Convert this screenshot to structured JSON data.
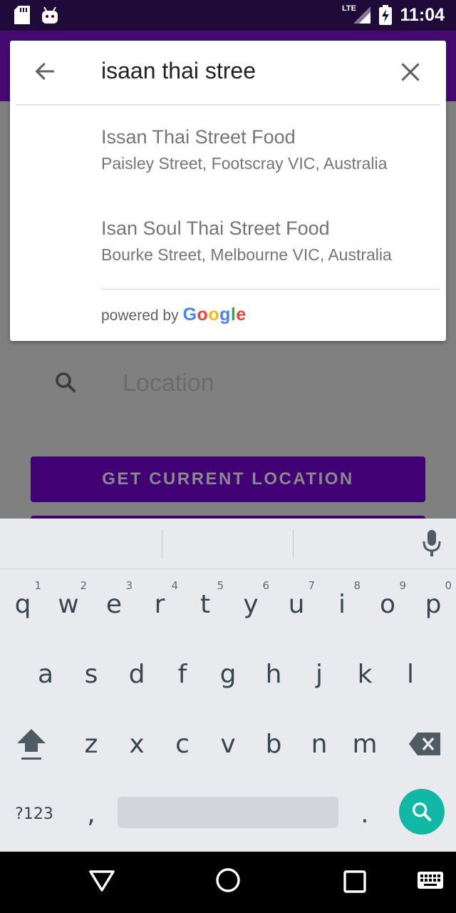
{
  "status_bar": {
    "time": "11:04",
    "network": "LTE",
    "icons": [
      "sd-card-icon",
      "android-icon",
      "signal-icon",
      "battery-charging-icon"
    ]
  },
  "search": {
    "query": "isaan thai stree",
    "suggestions": [
      {
        "name": "Issan Thai Street Food",
        "address": "Paisley Street, Footscray VIC, Australia"
      },
      {
        "name": "Isan Soul Thai Street Food",
        "address": "Bourke Street, Melbourne VIC, Australia"
      }
    ],
    "powered_by": "powered by",
    "google_letters": [
      "G",
      "o",
      "o",
      "g",
      "l",
      "e"
    ],
    "google_colors": [
      "#4285F4",
      "#EA4335",
      "#FBBC05",
      "#4285F4",
      "#34A853",
      "#EA4335"
    ]
  },
  "form": {
    "location_placeholder": "Location",
    "current_location_button": "GET CURRENT LOCATION"
  },
  "keyboard": {
    "row1": [
      {
        "k": "q",
        "h": "1"
      },
      {
        "k": "w",
        "h": "2"
      },
      {
        "k": "e",
        "h": "3"
      },
      {
        "k": "r",
        "h": "4"
      },
      {
        "k": "t",
        "h": "5"
      },
      {
        "k": "y",
        "h": "6"
      },
      {
        "k": "u",
        "h": "7"
      },
      {
        "k": "i",
        "h": "8"
      },
      {
        "k": "o",
        "h": "9"
      },
      {
        "k": "p",
        "h": "0"
      }
    ],
    "row2": [
      "a",
      "s",
      "d",
      "f",
      "g",
      "h",
      "j",
      "k",
      "l"
    ],
    "row3": [
      "z",
      "x",
      "c",
      "v",
      "b",
      "n",
      "m"
    ],
    "symbols_key": "?123",
    "comma_key": ",",
    "period_key": "."
  },
  "colors": {
    "app_bar": "#440a70",
    "button": "#420075",
    "search_key": "#11b8a6"
  }
}
